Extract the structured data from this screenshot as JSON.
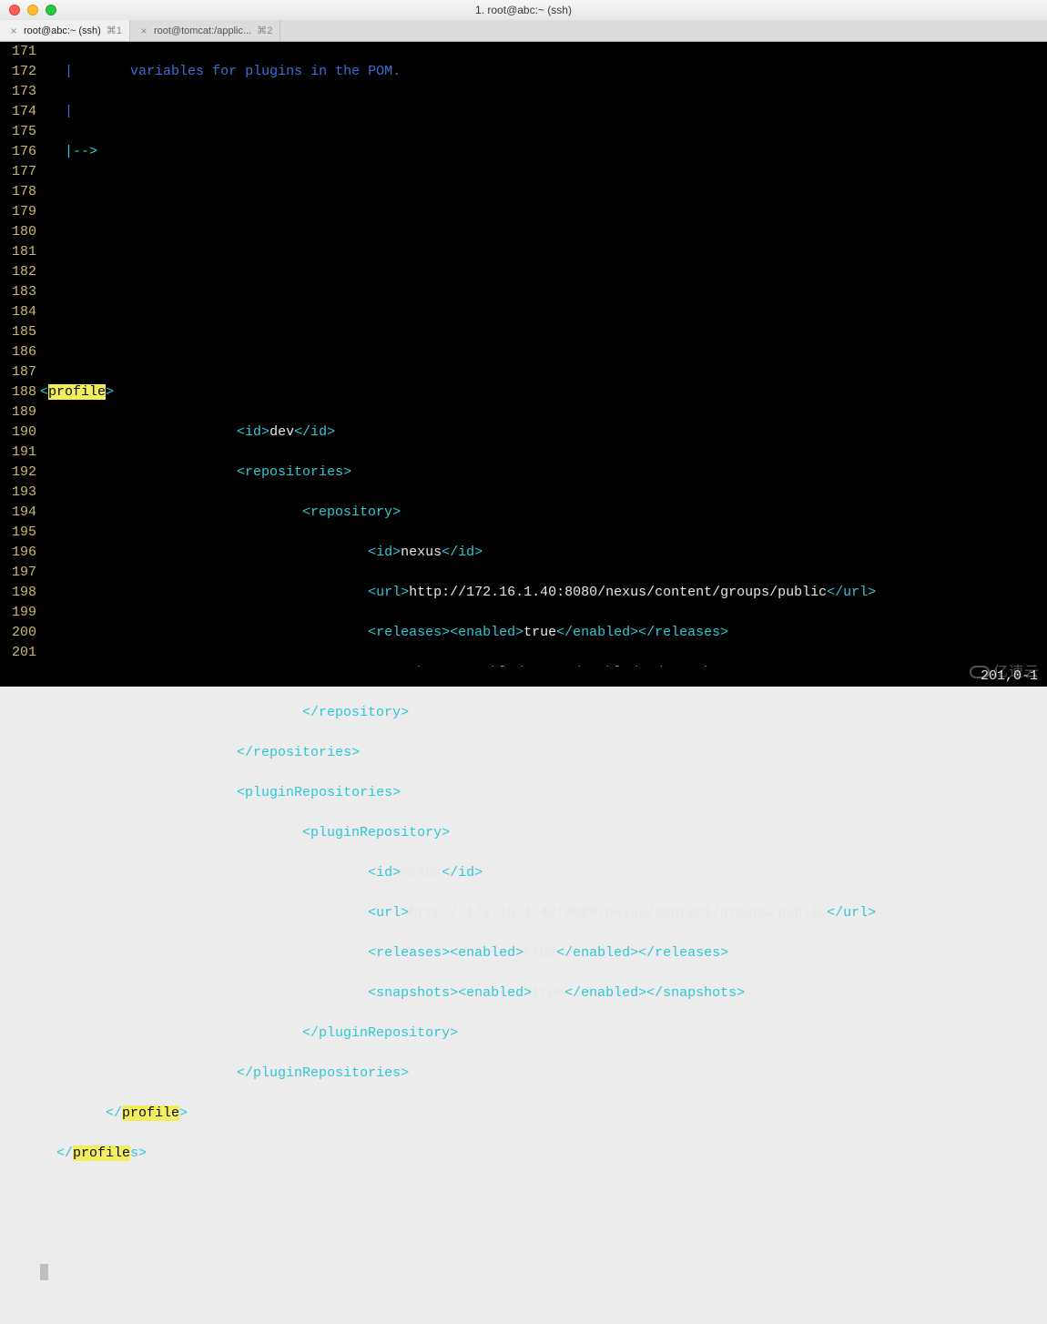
{
  "window": {
    "title": "1. root@abc:~ (ssh)"
  },
  "tabs": [
    {
      "label": "root@abc:~ (ssh)",
      "shortcut": "⌘1",
      "active": true
    },
    {
      "label": "root@tomcat:/applic...",
      "shortcut": "⌘2",
      "active": false
    }
  ],
  "status": {
    "position": "201,0-1"
  },
  "watermark": "亿速云",
  "gutter": {
    "start": 171,
    "end": 201
  },
  "code": {
    "l171": {
      "pipe": "|",
      "comment": "variables for plugins in the POM."
    },
    "l172": {
      "pipe": "|"
    },
    "l173": {
      "end": "|-->"
    },
    "l179": {
      "open": "<",
      "hl": "profile",
      "close": ">"
    },
    "l180": {
      "id_open": "<id>",
      "id_val": "dev",
      "id_close": "</id>"
    },
    "l181": {
      "repos_open": "<repositories>"
    },
    "l182": {
      "repo_open": "<repository>"
    },
    "l183": {
      "id_open": "<id>",
      "id_val": "nexus",
      "id_close": "</id>"
    },
    "l184": {
      "url_open": "<url>",
      "url_val": "http://172.16.1.40:8080/nexus/content/groups/public",
      "url_close": "</url>"
    },
    "l185": {
      "rel_open": "<releases>",
      "en_open": "<enabled>",
      "en_val": "true",
      "en_close": "</enabled>",
      "rel_close": "</releases>"
    },
    "l186": {
      "sn_open": "<snapshots>",
      "en_open": "<enabled>",
      "en_val": "true",
      "en_close": "</enabled>",
      "sn_close": "</snapshots>"
    },
    "l187": {
      "repo_close": "</repository>"
    },
    "l188": {
      "repos_close": "</repositories>"
    },
    "l189": {
      "prepos_open": "<pluginRepositories>"
    },
    "l190": {
      "prepo_open": "<pluginRepository>"
    },
    "l191": {
      "id_open": "<id>",
      "id_val": "nexus",
      "id_close": "</id>"
    },
    "l192": {
      "url_open": "<url>",
      "url_val": "http://172.16.1.40:8080/nexus/content/groups/public",
      "url_close": "</url>"
    },
    "l193": {
      "rel_open": "<releases>",
      "en_open": "<enabled>",
      "en_val": "true",
      "en_close": "</enabled>",
      "rel_close": "</releases>"
    },
    "l194": {
      "sn_open": "<snapshots>",
      "en_open": "<enabled>",
      "en_val": "true",
      "en_close": "</enabled>",
      "sn_close": "</snapshots>"
    },
    "l195": {
      "prepo_close": "</pluginRepository>"
    },
    "l196": {
      "prepos_close": "</pluginRepositories>"
    },
    "l197": {
      "open": "</",
      "hl": "profile",
      "close": ">"
    },
    "l198": {
      "open": "</",
      "hl": "profile",
      "tail": "s>"
    }
  }
}
